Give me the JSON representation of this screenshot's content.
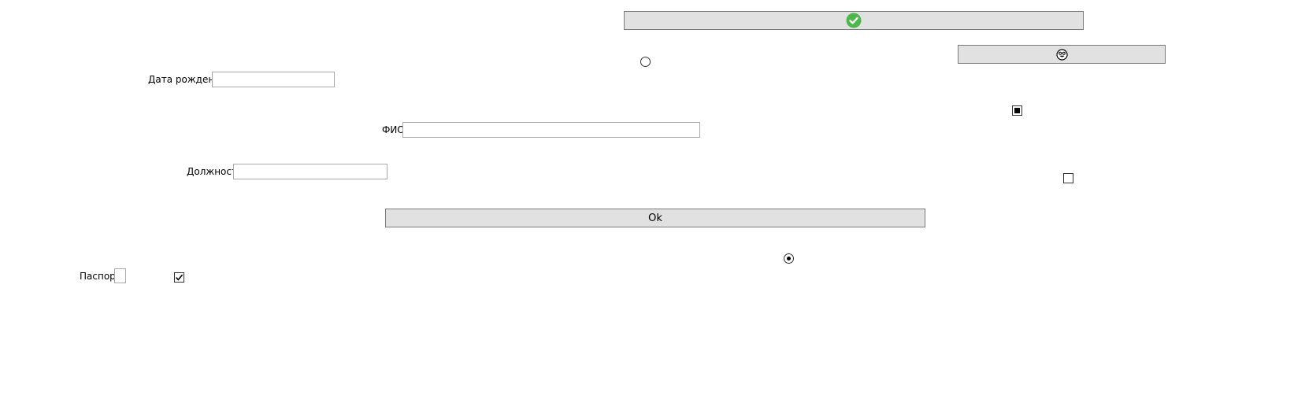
{
  "form": {
    "birth_date_label": "Дата рождения",
    "birth_date_value": "",
    "fio_label": "ФИО",
    "fio_value": "",
    "position_label": "Должность",
    "position_value": "",
    "passport_label": "Паспорт",
    "passport_value": "",
    "ok_button_label": "Ok"
  },
  "controls": {
    "top_button_icon": "checkmark-circle-icon",
    "smiley_button_icon": "smiley-face-icon",
    "radio_top_checked": false,
    "radio_bottom_checked": true,
    "checkbox_indeterminate_state": "indeterminate",
    "checkbox_right_checked": false,
    "checkbox_passport_checked": true
  },
  "colors": {
    "button_background": "#e1e1e1",
    "button_border": "#7a7a7a",
    "input_border": "#a9a9a9",
    "checkmark_icon_green": "#4cb84c"
  }
}
